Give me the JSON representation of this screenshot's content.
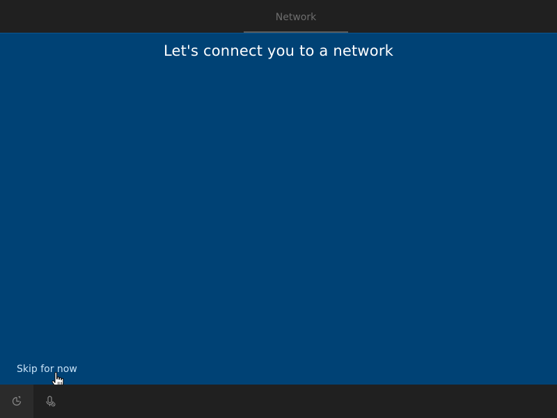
{
  "header": {
    "tabs": [
      {
        "label": "Network"
      }
    ]
  },
  "main": {
    "title": "Let's connect you to a network",
    "skip_label": "Skip for now",
    "background_color": "#004275"
  },
  "bottom_bar": {
    "buttons": [
      {
        "icon": "ease-of-access-icon"
      },
      {
        "icon": "microphone-icon"
      }
    ]
  }
}
